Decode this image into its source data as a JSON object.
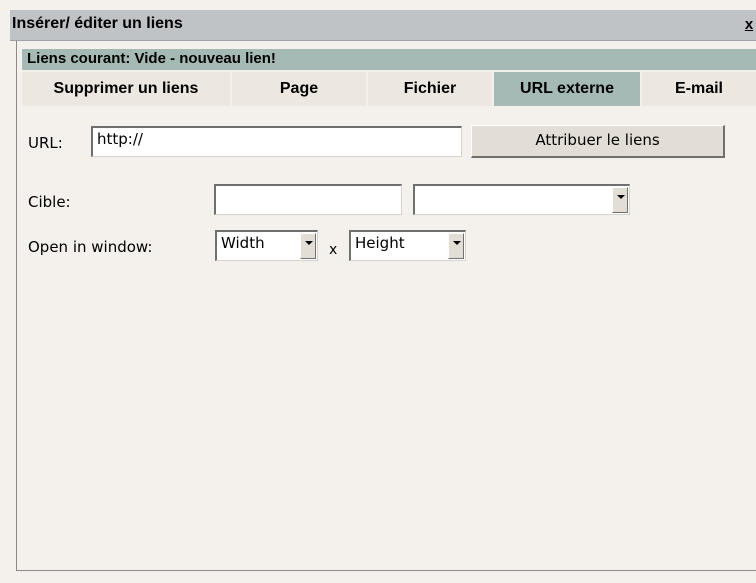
{
  "window": {
    "title": "Insérer/ éditer un liens",
    "close_label": "x"
  },
  "status": {
    "text": "Liens courant: Vide - nouveau lien!"
  },
  "tabs": [
    {
      "label": "Supprimer un liens",
      "active": false
    },
    {
      "label": "Page",
      "active": false
    },
    {
      "label": "Fichier",
      "active": false
    },
    {
      "label": "URL externe",
      "active": true
    },
    {
      "label": "E-mail",
      "active": false
    }
  ],
  "url": {
    "label": "URL:",
    "value": "http://",
    "button_label": "Attribuer le liens"
  },
  "target": {
    "label": "Cible:",
    "value": "",
    "select_value": ""
  },
  "open_window": {
    "label": "Open in window:",
    "width_select": "Width",
    "separator": "x",
    "height_select": "Height"
  },
  "colors": {
    "active_tab": "#a5bab4",
    "status_bar": "#a5bab4",
    "title_bar": "#c0c3c6",
    "dialog_bg": "#f4f1ec"
  }
}
